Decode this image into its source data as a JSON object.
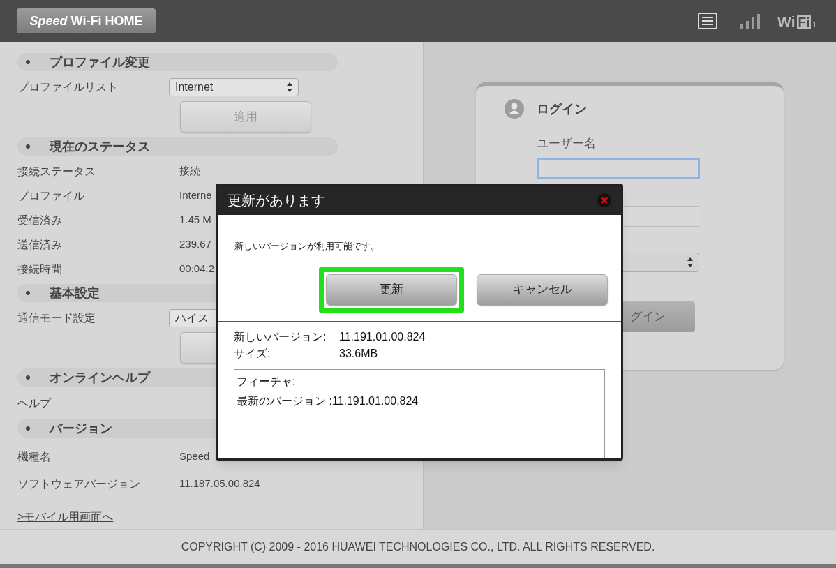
{
  "header": {
    "logo": "*Speed* Wi-Fi HOME",
    "wifi": {
      "text": "Wi",
      "box": "Fi",
      "index": "1"
    }
  },
  "sidebar": {
    "sections": [
      {
        "title": "プロファイル変更",
        "rows": [
          {
            "kind": "select",
            "label": "プロファイルリスト",
            "value": "Internet"
          },
          {
            "kind": "button",
            "label": "適用",
            "disabled": true
          }
        ]
      },
      {
        "title": "現在のステータス",
        "rows": [
          {
            "kind": "text",
            "label": "接続ステータス",
            "value": "接続"
          },
          {
            "kind": "text",
            "label": "プロファイル",
            "value": "Interne"
          },
          {
            "kind": "text",
            "label": "受信済み",
            "value": "1.45 M"
          },
          {
            "kind": "text",
            "label": "送信済み",
            "value": "239.67"
          },
          {
            "kind": "text",
            "label": "接続時間",
            "value": "00:04:2"
          }
        ]
      },
      {
        "title": "基本設定",
        "rows": [
          {
            "kind": "select",
            "label": "通信モード設定",
            "value": "ハイス"
          },
          {
            "kind": "button"
          }
        ]
      },
      {
        "title": "オンラインヘルプ",
        "rows": [
          {
            "kind": "link",
            "label": "ヘルプ"
          }
        ]
      },
      {
        "title": "バージョン",
        "rows": [
          {
            "kind": "text",
            "label": "機種名",
            "value": "Speed"
          },
          {
            "kind": "text",
            "label": "ソフトウェアバージョン",
            "value": "11.187.05.00.824"
          }
        ]
      }
    ],
    "mobile_link": ">モバイル用画面へ"
  },
  "login": {
    "title": "ログイン",
    "username_label": "ユーザー名",
    "username_focused": true,
    "button": "グイン"
  },
  "dialog": {
    "title": "更新があります",
    "message": "新しいバージョンが利用可能です。",
    "buttons": [
      {
        "label": "更新",
        "highlighted": true
      },
      {
        "label": "キャンセル",
        "highlighted": false
      }
    ],
    "info": [
      {
        "label": "新しいバージョン:",
        "value": "11.191.01.00.824"
      },
      {
        "label": "サイズ:",
        "value": "33.6MB"
      }
    ],
    "details": [
      "フィーチャ:",
      "最新のバージョン :11.191.01.00.824"
    ]
  },
  "footer": "COPYRIGHT (C) 2009 - 2016 HUAWEI TECHNOLOGIES CO., LTD. ALL RIGHTS RESERVED."
}
